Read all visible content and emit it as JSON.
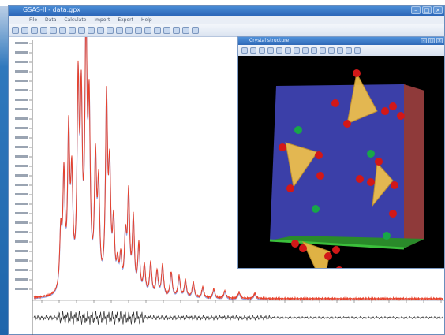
{
  "window": {
    "title": "GSAS-II - data.gpx",
    "menus": [
      "File",
      "Data",
      "Calculate",
      "Import",
      "Export",
      "Help"
    ],
    "controls": {
      "minimize": "–",
      "maximize": "□",
      "close": "×"
    }
  },
  "viewer": {
    "title": "Crystal structure",
    "controls": {
      "minimize": "–",
      "maximize": "□",
      "close": "×"
    },
    "colors": {
      "background": "#000000",
      "cell_face": "#3b3fa8",
      "cell_side": "#8f3a3a",
      "cell_bottom": "#2a8a2a",
      "tetrahedra": "#f2c24a",
      "oxygen": "#d21818",
      "cation": "#18a648"
    }
  },
  "plot": {
    "colors": {
      "observed": "#e8412a",
      "calculated": "#8fa2e6",
      "difference": "#333333"
    }
  }
}
